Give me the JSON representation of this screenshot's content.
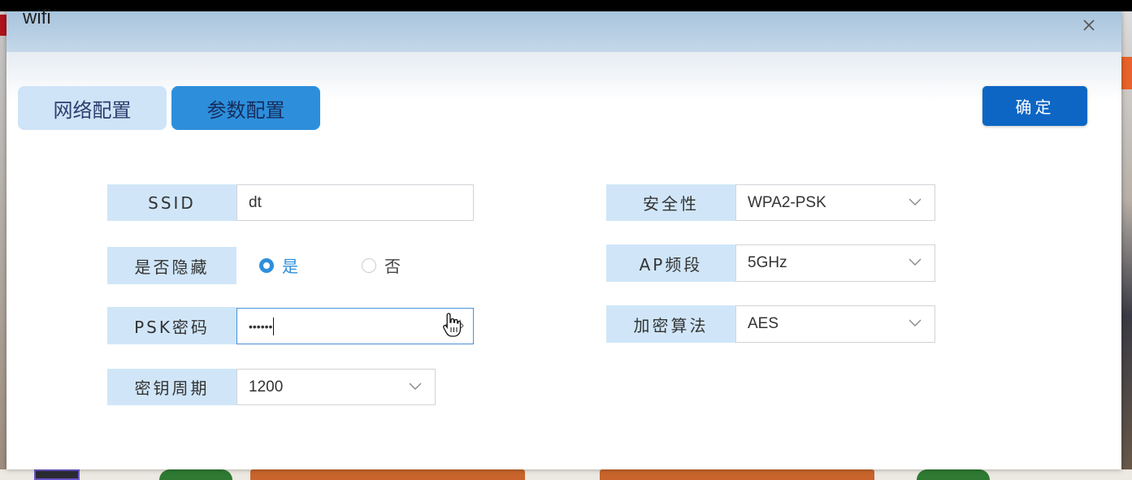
{
  "window": {
    "title": "wifi"
  },
  "tabs": [
    {
      "label": "网络配置",
      "active": false
    },
    {
      "label": "参数配置",
      "active": true
    }
  ],
  "actions": {
    "confirm_label": "确定"
  },
  "form": {
    "ssid": {
      "label": "SSID",
      "value": "dt"
    },
    "hidden": {
      "label": "是否隐藏",
      "options": [
        {
          "label": "是",
          "selected": true
        },
        {
          "label": "否",
          "selected": false
        }
      ]
    },
    "psk": {
      "label": "PSK密码",
      "value": "••••••"
    },
    "key_period": {
      "label": "密钥周期",
      "value": "1200"
    },
    "security": {
      "label": "安全性",
      "value": "WPA2-PSK"
    },
    "ap_band": {
      "label": "AP频段",
      "value": "5GHz"
    },
    "encryption": {
      "label": "加密算法",
      "value": "AES"
    }
  },
  "colors": {
    "accent": "#2d8fdc",
    "primary_button": "#0d66c4",
    "label_bg": "#d0e6f8",
    "header_gradient_top": "#a8c4dc"
  },
  "icons": [
    "close-icon",
    "chevron-down-icon",
    "eye-off-icon",
    "hand-pointer-icon"
  ]
}
